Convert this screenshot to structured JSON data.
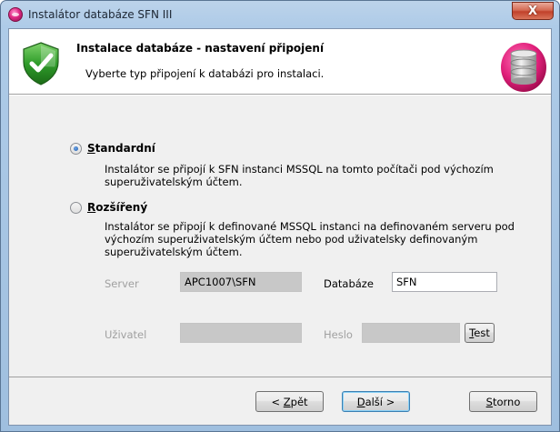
{
  "window": {
    "title": "Instalátor databáze SFN III",
    "close_label": "X"
  },
  "header": {
    "title": "Instalace databáze - nastavení připojení",
    "subtitle": "Vyberte typ připojení k databázi pro instalaci.",
    "left_icon": "shield-check-icon",
    "right_icon": "database-icon"
  },
  "options": {
    "standard": {
      "label_underlined": "S",
      "label_rest": "tandardní",
      "checked": true,
      "description": "Instalátor se připojí k SFN instanci MSSQL na tomto počítači pod výchozím superuživatelským účtem."
    },
    "extended": {
      "label_underlined": "R",
      "label_rest": "ozšířený",
      "checked": false,
      "description": "Instalátor se připojí k definované MSSQL instanci na definovaném serveru pod výchozím superuživatelským účtem nebo pod uživatelsky definovaným superuživatelským účtem."
    }
  },
  "fields": {
    "server_label": "Server",
    "server_value": "APC1007\\SFN",
    "database_label": "Databáze",
    "database_value": "SFN",
    "user_label": "Uživatel",
    "user_value": "",
    "password_label": "Heslo",
    "password_value": "",
    "test_underlined": "T",
    "test_rest": "est"
  },
  "buttons": {
    "back_prefix": "< ",
    "back_underlined": "Z",
    "back_rest": "pět",
    "next_underlined": "D",
    "next_rest": "alší >",
    "cancel_underlined": "S",
    "cancel_rest": "torno"
  }
}
